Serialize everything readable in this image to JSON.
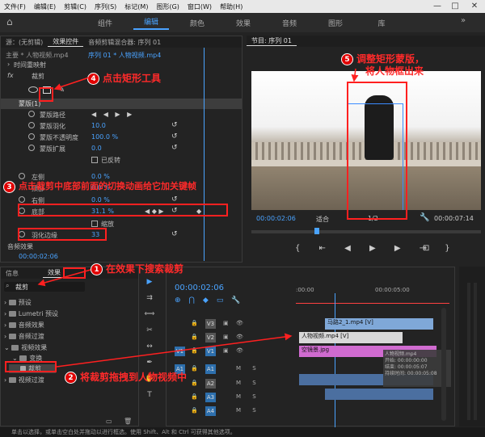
{
  "menu": [
    "文件(F)",
    "编辑(E)",
    "剪辑(C)",
    "序列(S)",
    "标记(M)",
    "图形(G)",
    "窗口(W)",
    "帮助(H)"
  ],
  "window_controls": {
    "minimize": "—",
    "maximize": "□",
    "close": "✕"
  },
  "workspaces": {
    "home": "⌂",
    "items": [
      "组件",
      "编辑",
      "颜色",
      "效果",
      "音频",
      "图形",
      "库"
    ],
    "active": "编辑",
    "more": "»"
  },
  "effect_controls": {
    "source_tab": "源：(无剪辑)",
    "tabs": [
      "效果控件",
      "音频剪辑混合器: 序列 01"
    ],
    "master": "主要 * 人物视频.mp4",
    "sequence": "序列 01 * 人物视频.mp4",
    "time_remap": "时间重映射",
    "fx_label": "fx",
    "crop_label": "裁剪",
    "mask_label": "蒙版(1)",
    "mask_path": "蒙版路径",
    "mask_feather": "蒙版羽化",
    "mask_feather_val": "10.0",
    "mask_opacity": "蒙版不透明度",
    "mask_opacity_val": "100.0 %",
    "mask_expand": "蒙版扩展",
    "mask_expand_val": "0.0",
    "inverted": "已反转",
    "left": "左侧",
    "left_val": "0.0 %",
    "top": "顶部",
    "top_val": "0.0 %",
    "right": "右侧",
    "right_val": "0.0 %",
    "bottom": "底部",
    "bottom_val": "31.1 %",
    "zoom": "缩放",
    "feather_edge": "羽化边缘",
    "feather_edge_val": "33",
    "audio_effects": "音频效果",
    "timecode": "00:00:02:06"
  },
  "program": {
    "title": "节目: 序列 01",
    "timecode": "00:00:02:06",
    "fit": "适合",
    "quality": "1/2",
    "duration": "00:00:07:14"
  },
  "project": {
    "tabs": [
      "信息",
      "效果"
    ],
    "search": "裁剪",
    "items": [
      "预设",
      "Lumetri 预设",
      "音频效果",
      "音频过渡",
      "视频效果",
      "变换",
      "裁剪",
      "视频过渡"
    ]
  },
  "timeline": {
    "timecode": "00:00:02:06",
    "ruler": [
      ":00:00",
      "00:00:05:00"
    ],
    "tracks": [
      {
        "name": "V3"
      },
      {
        "name": "V2"
      },
      {
        "name": "V1"
      },
      {
        "name": "A1"
      },
      {
        "name": "A2"
      },
      {
        "name": "A3"
      },
      {
        "name": "A4"
      }
    ],
    "src_v": "V1",
    "src_a": "A1",
    "clips": [
      "马路2_1.mp4 [V]",
      "人物视频.mp4 [V]",
      "空镜景.jpg"
    ],
    "tooltip": [
      "人物视频.mp4",
      "开始: 00:00:00:00",
      "结束: 00:00:05:07",
      "持续时间: 00:00:05:08"
    ],
    "fx_badge": "fx"
  },
  "status": "单击以选择，或单击空白处并拖动以进行框选。使用 Shift、Alt 和 Ctrl 可获得其他选项。",
  "annotations": {
    "a1": "在效果下搜索裁剪",
    "a2": "将裁剪拖拽到人物视频中",
    "a3": "点击裁剪中底部前面的切换动画给它加关键帧",
    "a4": "点击矩形工具",
    "a5_line1": "调整矩形蒙版，",
    "a5_line2": "将人物框出来",
    "n1": "1",
    "n2": "2",
    "n3": "3",
    "n4": "4",
    "n5": "5"
  },
  "colors": {
    "accent": "#4aa3ff",
    "annotation": "#ff2020",
    "clip_v3": "#7fa8d8",
    "clip_v2": "#d8d8d8",
    "clip_v1": "#d06bd0",
    "clip_audio": "#4b6fa0"
  }
}
